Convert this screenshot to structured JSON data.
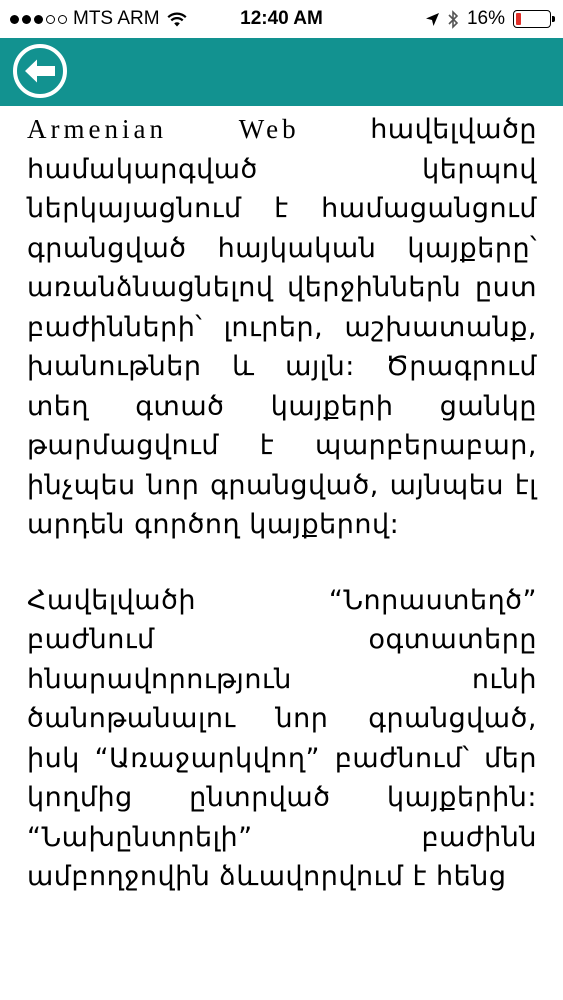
{
  "status_bar": {
    "carrier": "MTS ARM",
    "time": "12:40 AM",
    "battery_percent": "16%",
    "battery_level": 0.16,
    "battery_color": "#e0302a"
  },
  "nav_bar": {
    "color": "#129290",
    "back_icon": "arrow-left-circle-icon"
  },
  "article": {
    "p1_latin": "Armenian Web",
    "p1_rest": " հավելվածը համակարգված կերպով ներկայացնում է համացանցում գրանցված հայկական կայքերը՝ առանձնացնելով վերջիններն ըստ բաժինների՝ լուրեր, աշխատանք, խանութներ և այլն: Ծրագրում տեղ գտած կայքերի ցանկը թարմացվում է պարբերաբար, ինչպես նոր գրանցված, այնպես էլ արդեն գործող կայքերով:",
    "p2": "Հավելվածի “Նորաստեղծ” բաժնում օգտատերը հնարավորություն ունի ծանոթանալու նոր գրանցված, իսկ “Առաջարկվող” բաժնում՝ մեր կողմից ընտրված կայքերին: “Նախընտրելի” բաժինն ամբողջովին ձևավորվում է հենց"
  }
}
